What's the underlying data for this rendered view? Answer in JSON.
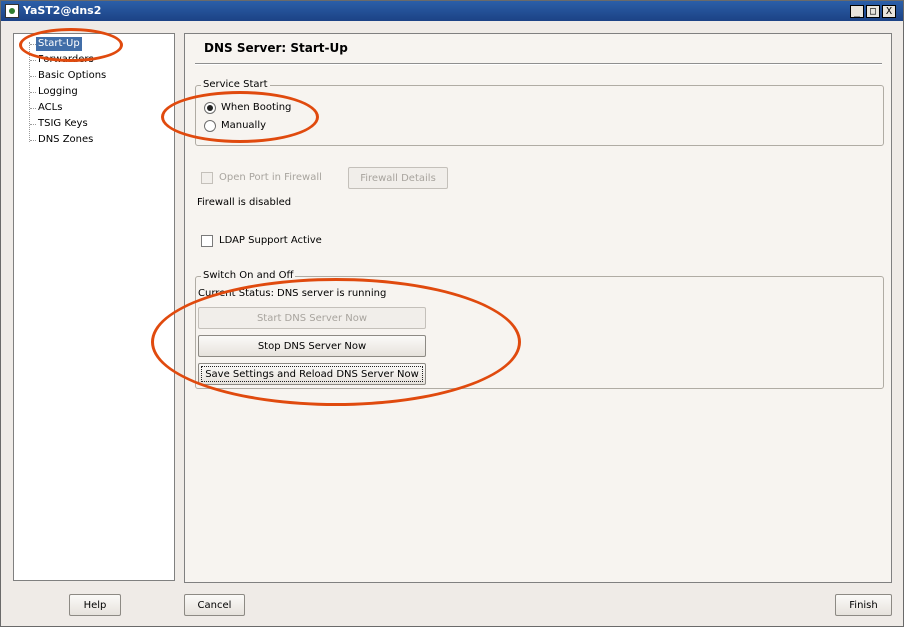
{
  "window": {
    "title": "YaST2@dns2",
    "controls": {
      "minimize": "_",
      "maximize": "□",
      "close": "X"
    }
  },
  "sidebar": {
    "items": [
      {
        "label": "Start-Up",
        "selected": true
      },
      {
        "label": "Forwarders",
        "selected": false
      },
      {
        "label": "Basic Options",
        "selected": false
      },
      {
        "label": "Logging",
        "selected": false
      },
      {
        "label": "ACLs",
        "selected": false
      },
      {
        "label": "TSIG Keys",
        "selected": false
      },
      {
        "label": "DNS Zones",
        "selected": false
      }
    ]
  },
  "main": {
    "title": "DNS Server: Start-Up",
    "service_start": {
      "legend": "Service Start",
      "options": [
        {
          "label": "When Booting",
          "checked": true
        },
        {
          "label": "Manually",
          "checked": false
        }
      ]
    },
    "firewall": {
      "open_port_label": "Open Port in Firewall",
      "open_port_checked": false,
      "details_button": "Firewall Details",
      "status_text": "Firewall is disabled"
    },
    "ldap": {
      "label": "LDAP Support Active",
      "checked": false
    },
    "switch": {
      "legend": "Switch On and Off",
      "status_label": "Current Status:",
      "status_value": "DNS server is running",
      "start_button": "Start DNS Server Now",
      "stop_button": "Stop DNS Server Now",
      "save_reload_button": "Save Settings and Reload DNS Server Now"
    }
  },
  "footer": {
    "help": "Help",
    "cancel": "Cancel",
    "finish": "Finish"
  },
  "annotation_color": "#e04a0e"
}
